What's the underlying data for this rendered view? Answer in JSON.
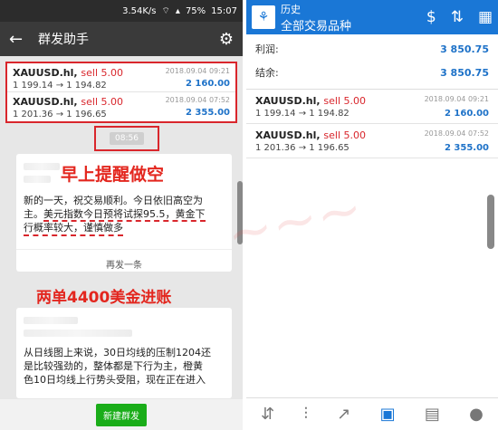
{
  "left": {
    "status": {
      "speed": "3.54K/s",
      "battery": "75%",
      "time": "15:07"
    },
    "appbar": {
      "title": "群发助手"
    },
    "trades": [
      {
        "symbol": "XAUUSD.hl,",
        "side": "sell 5.00",
        "prices": "1 199.14 → 1 194.82",
        "date": "2018.09.04 09:21",
        "profit": "2 160.00"
      },
      {
        "symbol": "XAUUSD.hl,",
        "side": "sell 5.00",
        "prices": "1 201.36 → 1 196.65",
        "date": "2018.09.04 07:52",
        "profit": "2 355.00"
      }
    ],
    "time_stamp": "08:56",
    "annotation_1": "早上提醒做空",
    "message_1": {
      "line1": "新的一天，祝交易顺利。今日依旧高空为",
      "line2a": "主。",
      "line2b": "美元指数今日预将试探95.5，黄金下",
      "line3": "行概率较大，谨慎做多"
    },
    "resend_label": "再发一条",
    "annotation_2": "两单4400美金进账",
    "message_2": {
      "line1": "从日线图上来说，30日均线的压制1204还",
      "line2": "是比较强劲的，整体都是下行为主，橙黄",
      "line3": "色10日均线上行势头受阻，现在正在进入"
    },
    "new_broadcast_label": "新建群发"
  },
  "right": {
    "header": {
      "title": "历史",
      "subtitle": "全部交易品种"
    },
    "summary": [
      {
        "label": "利润:",
        "value": "3 850.75"
      },
      {
        "label": "结余:",
        "value": "3 850.75"
      }
    ],
    "trades": [
      {
        "symbol": "XAUUSD.hl,",
        "side": "sell 5.00",
        "prices": "1 199.14 → 1 194.82",
        "date": "2018.09.04 09:21",
        "profit": "2 160.00"
      },
      {
        "symbol": "XAUUSD.hl,",
        "side": "sell 5.00",
        "prices": "1 201.36 → 1 196.65",
        "date": "2018.09.04 07:52",
        "profit": "2 355.00"
      }
    ]
  },
  "colors": {
    "accent_blue": "#1a77d6",
    "annotation_red": "#e3261e",
    "wechat_green": "#1aad19"
  }
}
